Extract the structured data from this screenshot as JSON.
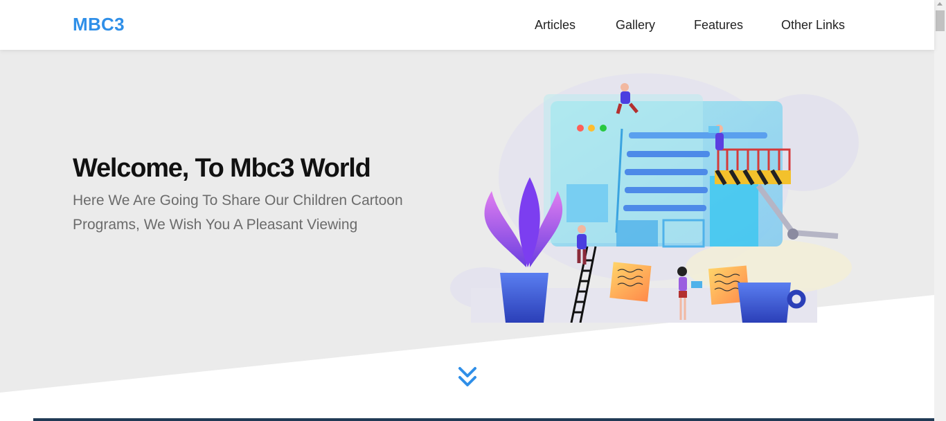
{
  "header": {
    "logo": "MBC3",
    "nav": [
      {
        "label": "Articles"
      },
      {
        "label": "Gallery"
      },
      {
        "label": "Features"
      },
      {
        "label": "Other Links"
      }
    ]
  },
  "hero": {
    "title": "Welcome, To Mbc3 World",
    "subtitle": "Here We Are Going To Share Our Children Cartoon Programs, We Wish You A Pleasant Viewing",
    "scroll_icon": "double-chevron-down-icon"
  },
  "colors": {
    "brand": "#2f8fe8",
    "hero_bg": "#ebebeb",
    "text_dark": "#111111",
    "text_muted": "#6b6b6b"
  }
}
